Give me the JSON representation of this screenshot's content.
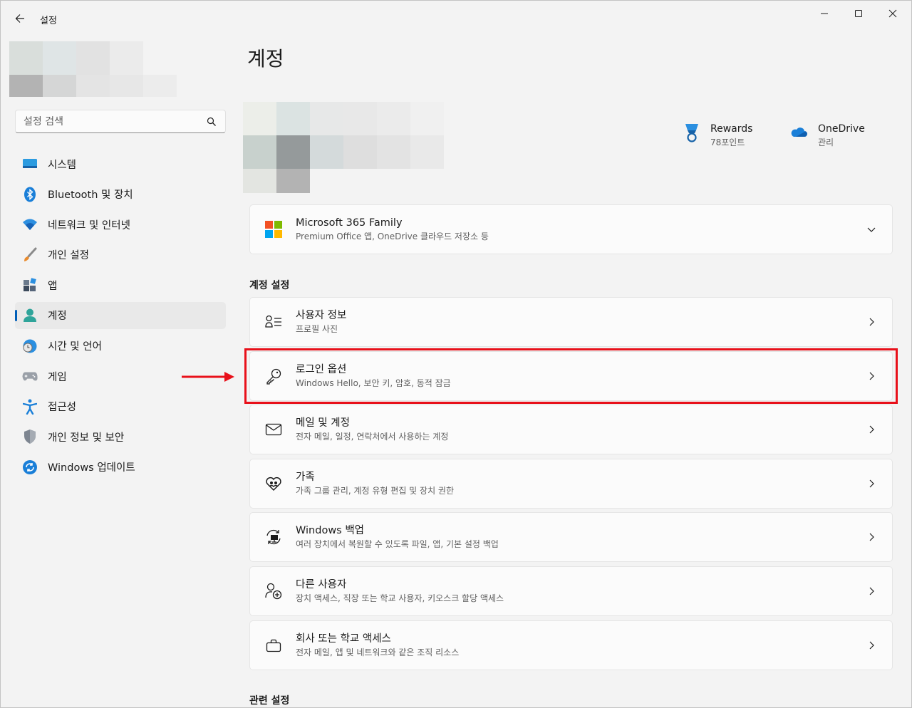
{
  "window": {
    "title": "설정",
    "controls": [
      "minimize",
      "maximize",
      "close"
    ]
  },
  "sidebar": {
    "search_placeholder": "설정 검색",
    "items": [
      {
        "label": "시스템",
        "icon": "system-icon",
        "active": false
      },
      {
        "label": "Bluetooth 및 장치",
        "icon": "bluetooth-icon",
        "active": false
      },
      {
        "label": "네트워크 및 인터넷",
        "icon": "wifi-icon",
        "active": false
      },
      {
        "label": "개인 설정",
        "icon": "brush-icon",
        "active": false
      },
      {
        "label": "앱",
        "icon": "apps-icon",
        "active": false
      },
      {
        "label": "계정",
        "icon": "account-icon",
        "active": true
      },
      {
        "label": "시간 및 언어",
        "icon": "clock-globe-icon",
        "active": false
      },
      {
        "label": "게임",
        "icon": "gamepad-icon",
        "active": false
      },
      {
        "label": "접근성",
        "icon": "accessibility-icon",
        "active": false
      },
      {
        "label": "개인 정보 및 보안",
        "icon": "shield-icon",
        "active": false
      },
      {
        "label": "Windows 업데이트",
        "icon": "update-icon",
        "active": false
      }
    ]
  },
  "main": {
    "title": "계정",
    "services": [
      {
        "name": "Rewards",
        "sub": "78포인트",
        "icon": "rewards-medal-icon"
      },
      {
        "name": "OneDrive",
        "sub": "관리",
        "icon": "onedrive-cloud-icon"
      }
    ],
    "subscription": {
      "title": "Microsoft 365 Family",
      "subtitle": "Premium Office 앱, OneDrive 클라우드 저장소 등"
    },
    "section_account": "계정 설정",
    "cards": [
      {
        "title": "사용자 정보",
        "subtitle": "프로필 사진",
        "icon": "user-info-icon"
      },
      {
        "title": "로그인 옵션",
        "subtitle": "Windows Hello, 보안 키, 암호, 동적 잠금",
        "icon": "key-icon"
      },
      {
        "title": "메일 및 계정",
        "subtitle": "전자 메일, 일정, 연락처에서 사용하는 계정",
        "icon": "mail-icon"
      },
      {
        "title": "가족",
        "subtitle": "가족 그룹 관리, 계정 유형 편집 및 장치 권한",
        "icon": "family-heart-icon"
      },
      {
        "title": "Windows 백업",
        "subtitle": "여러 장치에서 복원할 수 있도록 파일, 앱, 기본 설정 백업",
        "icon": "backup-icon"
      },
      {
        "title": "다른 사용자",
        "subtitle": "장치 액세스, 직장 또는 학교 사용자, 키오스크 할당 액세스",
        "icon": "add-user-icon"
      },
      {
        "title": "회사 또는 학교 액세스",
        "subtitle": "전자 메일, 앱 및 네트워크와 같은 조직 리소스",
        "icon": "briefcase-icon"
      }
    ],
    "section_related": "관련 설정"
  },
  "colors": {
    "accent": "#005fb8",
    "highlight_border": "#e8101a",
    "card_bg": "#fbfbfb",
    "window_bg": "#f3f3f3"
  }
}
